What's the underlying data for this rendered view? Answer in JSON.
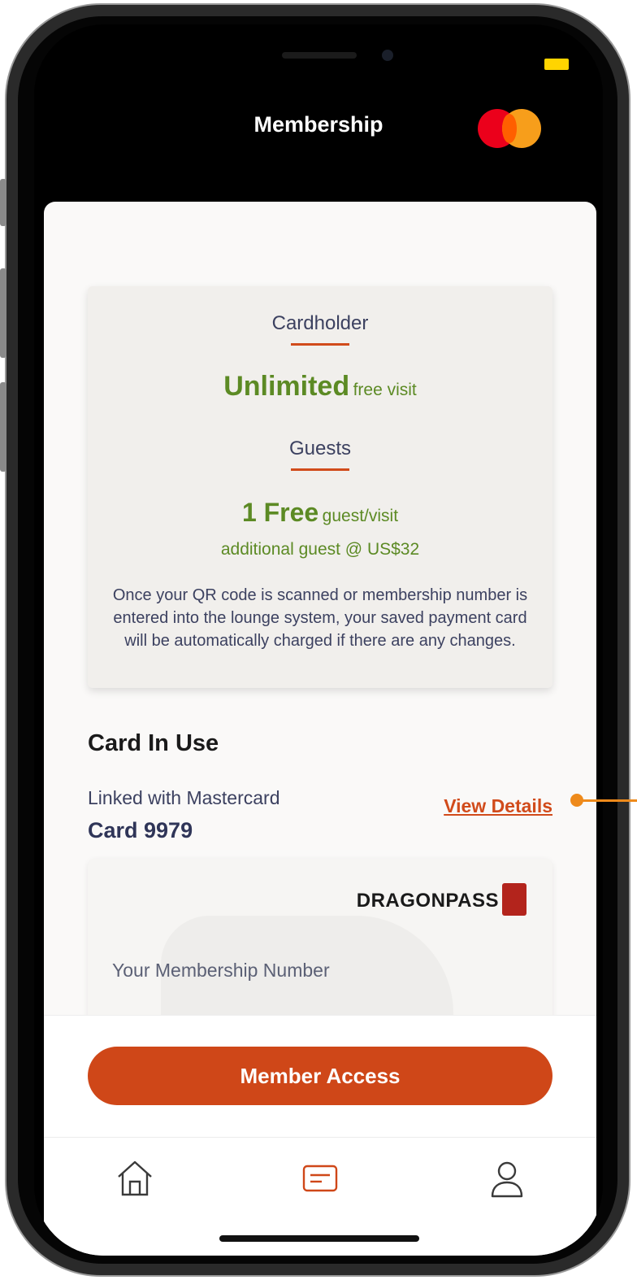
{
  "header": {
    "title": "Membership",
    "brand_icon": "mastercard-logo-icon"
  },
  "benefits": {
    "cardholder_label": "Cardholder",
    "cardholder_value": "Unlimited",
    "cardholder_unit": "free visit",
    "guests_label": "Guests",
    "guests_value": "1 Free",
    "guests_unit": "guest/visit",
    "additional_guest": "additional guest @ US$32",
    "note": "Once your QR code is scanned or membership number is entered into the lounge system, your saved payment card will be automatically charged if there are any changes."
  },
  "card_in_use": {
    "title": "Card In Use",
    "linked_with": "Linked with Mastercard",
    "card_number": "Card 9979",
    "view_details": "View Details"
  },
  "membership_card": {
    "brand": "DRAGONPASS",
    "member_number_label": "Your Membership Number"
  },
  "actions": {
    "member_access": "Member Access"
  },
  "tabbar": {
    "items": [
      {
        "name": "home",
        "icon": "home-icon",
        "active": false
      },
      {
        "name": "membership",
        "icon": "card-icon",
        "active": true
      },
      {
        "name": "profile",
        "icon": "user-icon",
        "active": false
      }
    ]
  },
  "colors": {
    "accent": "#cf4718",
    "green": "#5c8a24",
    "text_dark": "#3c4160",
    "pointer": "#ee8a1b"
  }
}
